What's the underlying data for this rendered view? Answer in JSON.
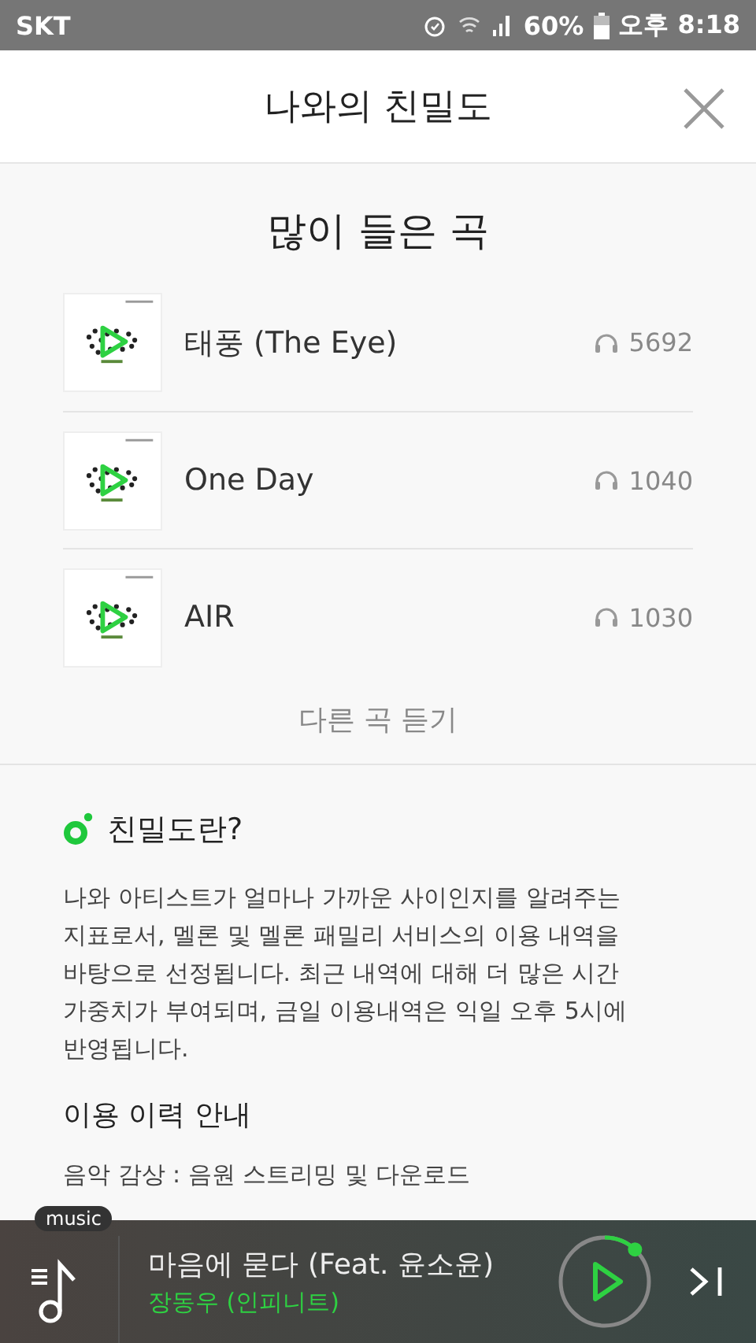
{
  "status_bar": {
    "carrier": "SKT",
    "battery": "60%",
    "time": "오후 8:18"
  },
  "header": {
    "title": "나와의 친밀도"
  },
  "top_songs": {
    "title": "많이 들은 곡",
    "songs": [
      {
        "title": "태풍 (The Eye)",
        "plays": "5692"
      },
      {
        "title": "One Day",
        "plays": "1040"
      },
      {
        "title": "AIR",
        "plays": "1030"
      }
    ],
    "more": "다른 곡 듣기"
  },
  "about": {
    "title": "친밀도란?",
    "body": "나와 아티스트가 얼마나 가까운 사이인지를 알려주는 지표로서, 멜론 및 멜론 패밀리 서비스의 이용 내역을 바탕으로 선정됩니다. 최근 내역에 대해 더 많은 시간 가중치가 부여되며, 금일 이용내역은 익일 오후 5시에 반영됩니다.",
    "history_title": "이용 이력 안내",
    "history": [
      "음악 감상 : 음원 스트리밍 및 다운로드"
    ]
  },
  "player": {
    "badge": "music",
    "title": "마음에 묻다 (Feat. 윤소윤)",
    "artist": "장동우 (인피니트)",
    "level": 0.12
  }
}
